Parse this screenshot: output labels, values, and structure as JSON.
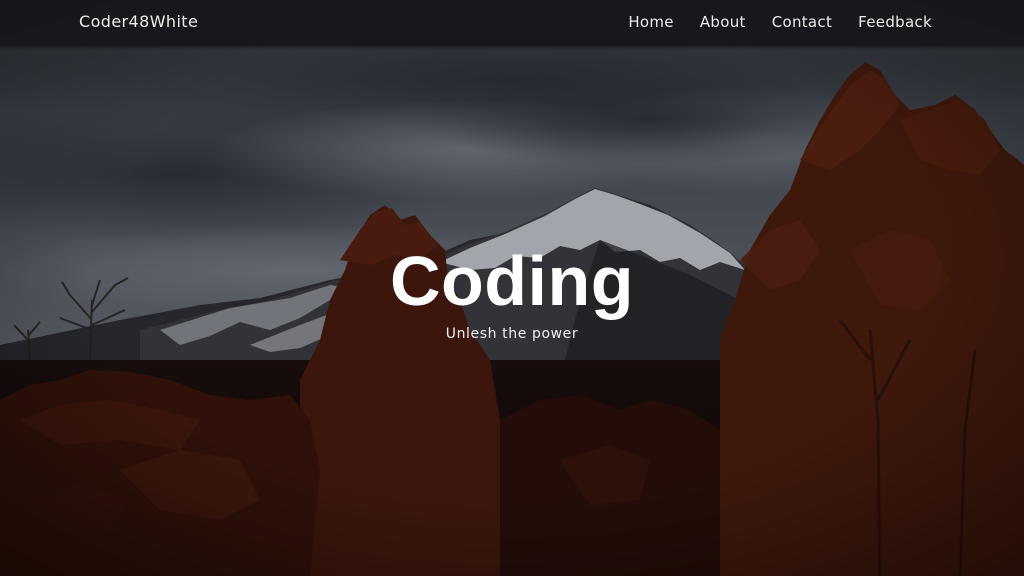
{
  "navbar": {
    "brand": "Coder48White",
    "links": [
      "Home",
      "About",
      "Contact",
      "Feedback"
    ]
  },
  "hero": {
    "title": "Coding",
    "subtitle": "Unlesh the power",
    "background_colors": {
      "sky": "#5b616b",
      "mountain_snow": "#c9ced5",
      "foliage": "#4a1c10",
      "ground": "#0f0707"
    }
  }
}
